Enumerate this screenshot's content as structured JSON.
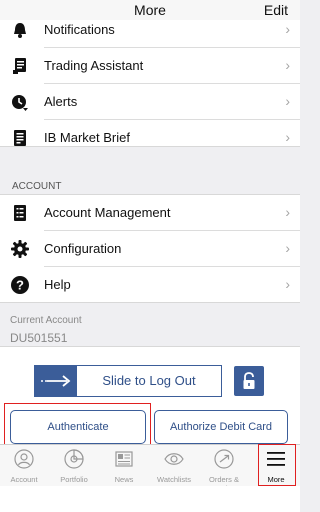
{
  "header": {
    "title": "More",
    "edit_label": "Edit"
  },
  "menu_top": [
    {
      "label": "Notifications",
      "icon": "bell-icon"
    },
    {
      "label": "Trading Assistant",
      "icon": "assistant-doc-icon"
    },
    {
      "label": "Alerts",
      "icon": "alert-bell-icon"
    },
    {
      "label": "IB Market Brief",
      "icon": "document-icon"
    }
  ],
  "account_section": {
    "heading": "ACCOUNT",
    "items": [
      {
        "label": "Account Management",
        "icon": "account-list-icon"
      },
      {
        "label": "Configuration",
        "icon": "gear-icon"
      },
      {
        "label": "Help",
        "icon": "help-icon"
      }
    ]
  },
  "current_account": {
    "label": "Current Account",
    "value": "DU501551"
  },
  "logout": {
    "slider_label": "Slide to Log Out"
  },
  "actions": {
    "authenticate_label": "Authenticate",
    "debit_label": "Authorize Debit Card"
  },
  "tabs": [
    {
      "label": "Account",
      "icon": "person-icon"
    },
    {
      "label": "Portfolio",
      "icon": "pie-chart-icon"
    },
    {
      "label": "News",
      "icon": "newspaper-icon"
    },
    {
      "label": "Watchlists",
      "icon": "eye-icon"
    },
    {
      "label": "Orders & Trades",
      "icon": "trades-icon"
    },
    {
      "label": "More",
      "icon": "hamburger-icon",
      "active": true
    }
  ],
  "colors": {
    "accent": "#3b5d99",
    "highlight_red": "#e02020"
  }
}
